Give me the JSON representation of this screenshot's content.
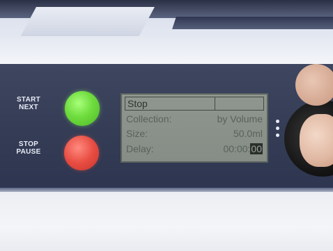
{
  "panel": {
    "start_label": "START\nNEXT",
    "stop_label": "STOP\nPAUSE",
    "start_color": "#6fdc3e",
    "stop_color": "#e84d42"
  },
  "lcd": {
    "status": "Stop",
    "rows": [
      {
        "key": "Collection:",
        "value": "by Volume"
      },
      {
        "key": "Size:",
        "value": "50.0ml"
      },
      {
        "key": "Delay:",
        "value": "00:00:",
        "cursor": "00"
      }
    ]
  },
  "knob": {
    "icon": "vertical-dots-icon"
  }
}
